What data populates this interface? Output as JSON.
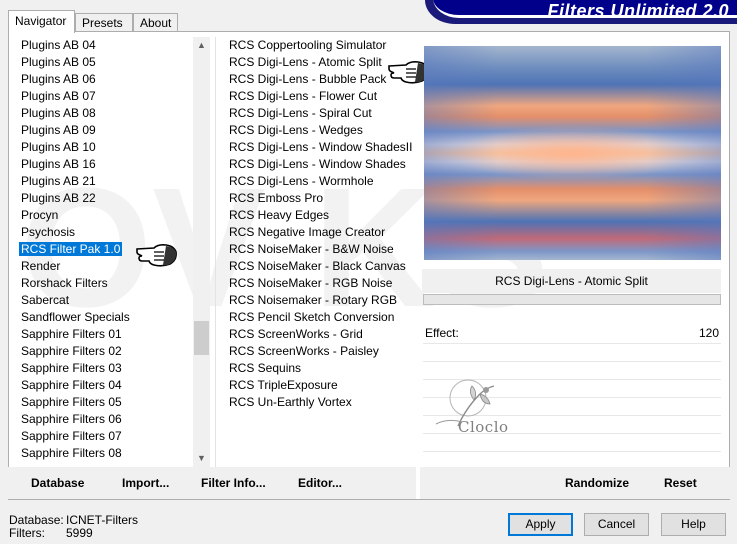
{
  "tabs": [
    {
      "label": "Navigator",
      "active": true
    },
    {
      "label": "Presets",
      "active": false
    },
    {
      "label": "About",
      "active": false
    }
  ],
  "banner": {
    "title": "Filters Unlimited 2.0"
  },
  "categories": [
    {
      "label": "Plugins AB 04"
    },
    {
      "label": "Plugins AB 05"
    },
    {
      "label": "Plugins AB 06"
    },
    {
      "label": "Plugins AB 07"
    },
    {
      "label": "Plugins AB 08"
    },
    {
      "label": "Plugins AB 09"
    },
    {
      "label": "Plugins AB 10"
    },
    {
      "label": "Plugins AB 16"
    },
    {
      "label": "Plugins AB 21"
    },
    {
      "label": "Plugins AB 22"
    },
    {
      "label": "Procyn"
    },
    {
      "label": "Psychosis"
    },
    {
      "label": "RCS Filter Pak 1.0"
    },
    {
      "label": "Render"
    },
    {
      "label": "Rorshack Filters"
    },
    {
      "label": "Sabercat"
    },
    {
      "label": "Sandflower Specials"
    },
    {
      "label": "Sapphire Filters 01"
    },
    {
      "label": "Sapphire Filters 02"
    },
    {
      "label": "Sapphire Filters 03"
    },
    {
      "label": "Sapphire Filters 04"
    },
    {
      "label": "Sapphire Filters 05"
    },
    {
      "label": "Sapphire Filters 06"
    },
    {
      "label": "Sapphire Filters 07"
    },
    {
      "label": "Sapphire Filters 08"
    }
  ],
  "selected_category": "RCS Filter Pak 1.0",
  "filters": [
    {
      "label": "RCS Coppertooling Simulator"
    },
    {
      "label": "RCS Digi-Lens - Atomic Split"
    },
    {
      "label": "RCS Digi-Lens - Bubble Pack"
    },
    {
      "label": "RCS Digi-Lens - Flower Cut"
    },
    {
      "label": "RCS Digi-Lens - Spiral Cut"
    },
    {
      "label": "RCS Digi-Lens - Wedges"
    },
    {
      "label": "RCS Digi-Lens - Window ShadesII"
    },
    {
      "label": "RCS Digi-Lens - Window Shades"
    },
    {
      "label": "RCS Digi-Lens - Wormhole"
    },
    {
      "label": "RCS Emboss Pro"
    },
    {
      "label": "RCS Heavy Edges"
    },
    {
      "label": "RCS Negative Image Creator"
    },
    {
      "label": "RCS NoiseMaker - B&W Noise"
    },
    {
      "label": "RCS NoiseMaker - Black Canvas"
    },
    {
      "label": "RCS NoiseMaker - RGB Noise"
    },
    {
      "label": "RCS Noisemaker - Rotary RGB"
    },
    {
      "label": "RCS Pencil Sketch Conversion"
    },
    {
      "label": "RCS ScreenWorks - Grid"
    },
    {
      "label": "RCS ScreenWorks - Paisley"
    },
    {
      "label": "RCS Sequins"
    },
    {
      "label": "RCS TripleExposure"
    },
    {
      "label": "RCS Un-Earthly Vortex"
    }
  ],
  "preview": {
    "filter_name": "RCS Digi-Lens - Atomic Split",
    "param_label": "Effect:",
    "param_value": "120"
  },
  "logo": {
    "text": "Cloclo"
  },
  "watermark": "OV  KS",
  "toolbar": {
    "database": "Database",
    "import": "Import...",
    "filter_info": "Filter Info...",
    "editor": "Editor...",
    "randomize": "Randomize",
    "reset": "Reset"
  },
  "footer": {
    "database_label": "Database:",
    "database_value": "ICNET-Filters",
    "filters_label": "Filters:",
    "filters_value": "5999",
    "apply": "Apply",
    "cancel": "Cancel",
    "help": "Help"
  },
  "colors": {
    "selection": "#0078d7",
    "banner": "#00008b"
  }
}
